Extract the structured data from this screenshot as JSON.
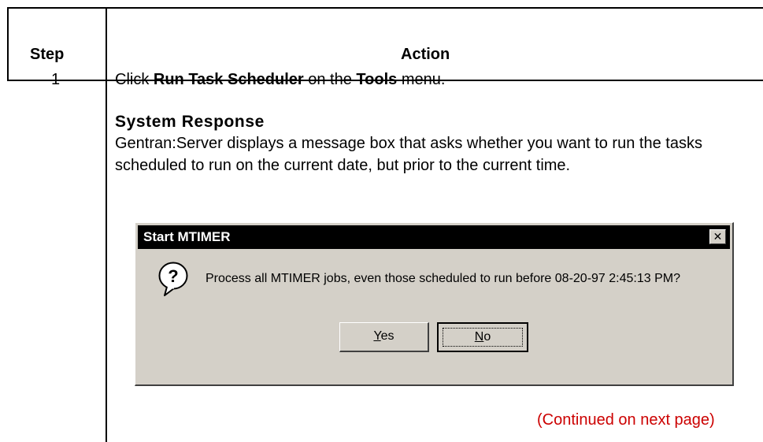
{
  "table": {
    "header_step": "Step",
    "header_action": "Action"
  },
  "step": {
    "number": "1",
    "instruction": {
      "prefix": "Click ",
      "command": "Run Task Scheduler",
      "middle": " on the ",
      "menu": "Tools",
      "suffix": " menu."
    },
    "response_heading": "System Response",
    "response_text": "Gentran:Server displays a message box that asks whether you want to run the tasks scheduled to run on the current date, but prior to the current time."
  },
  "dialog": {
    "title": "Start MTIMER",
    "close_glyph": "✕",
    "icon": "question-icon",
    "message": "Process all MTIMER jobs, even those scheduled to run before 08-20-97  2:45:13 PM?",
    "yes_mnemonic": "Y",
    "yes_rest": "es",
    "no_mnemonic": "N",
    "no_rest": "o"
  },
  "continued": "(Continued on next page)",
  "colors": {
    "continued_text": "#cc0000",
    "dialog_face": "#d4d0c8",
    "titlebar": "#000000"
  }
}
